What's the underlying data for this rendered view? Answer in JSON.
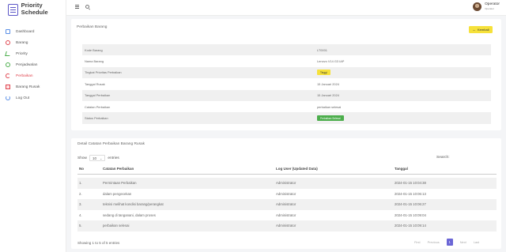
{
  "brand": {
    "title": "Priority Schedule"
  },
  "sidebar": {
    "items": [
      {
        "label": "Dashboard",
        "icon": "home-icon"
      },
      {
        "label": "Barang",
        "icon": "box-icon"
      },
      {
        "label": "Priority",
        "icon": "edit-icon"
      },
      {
        "label": "Penjadwalan",
        "icon": "clock-icon"
      },
      {
        "label": "Perbaikan",
        "icon": "repair-icon",
        "active": true
      },
      {
        "label": "Barang Rusak",
        "icon": "broken-item-icon"
      },
      {
        "label": "Log Out",
        "icon": "logout-icon"
      }
    ]
  },
  "header": {
    "user_name": "Operator",
    "user_role": "Operator"
  },
  "detail_card": {
    "title": "Perbaikan Barang",
    "back_label": "Kembali",
    "rows": [
      {
        "label": "Kode Barang",
        "value": "LT0001"
      },
      {
        "label": "Nama Barang",
        "value": "Lenovo V14 G3 IAP"
      },
      {
        "label": "Tingkat Prioritas Perbaikan",
        "badge": "Tinggi"
      },
      {
        "label": "Tanggal Rusak",
        "value": "15 Januari 2024"
      },
      {
        "label": "Tanggal Perbaikan",
        "value": "15 Januari 2024"
      },
      {
        "label": "Catatan Perbaikan",
        "value": "perbaikan selesai"
      },
      {
        "label": "Status Perbaikan",
        "badge": "Perbaikan Selesai"
      }
    ]
  },
  "log_card": {
    "title": "Detail Catatan Perbaikan Barang Rusak",
    "show_label": "Show",
    "entries_value": "10",
    "entries_label": "entries",
    "search_label": "Search:",
    "columns": [
      "No",
      "Catatan Perbaikan",
      "Log User (Updated Data)",
      "Tanggal"
    ],
    "rows": [
      [
        "1.",
        "Permintaan Perbaikan",
        "Administrator",
        "2024-01-15 10:04:38"
      ],
      [
        "2.",
        "dalam pengecekan",
        "Administrator",
        "2024-01-15 10:06:13"
      ],
      [
        "3.",
        "teknisi melihat kondisi barang/perangkat",
        "Administrator",
        "2024-01-15 10:06:27"
      ],
      [
        "4.",
        "sedang di tanganani, dalam proses",
        "Administrator",
        "2024-01-15 10:09:04"
      ],
      [
        "5.",
        "perbaikan selesai",
        "Administrator",
        "2024-01-15 10:09:14"
      ]
    ],
    "info": "Showing 1 to 5 of 5 entries",
    "pager": {
      "first": "First",
      "previous": "Previous",
      "current": "1",
      "next": "Next",
      "last": "Last"
    }
  },
  "colors": {
    "accent": "#6b66d6",
    "active_nav": "#e0454f",
    "badge_yellow": "#f6e13a",
    "badge_green": "#4cae4c"
  }
}
